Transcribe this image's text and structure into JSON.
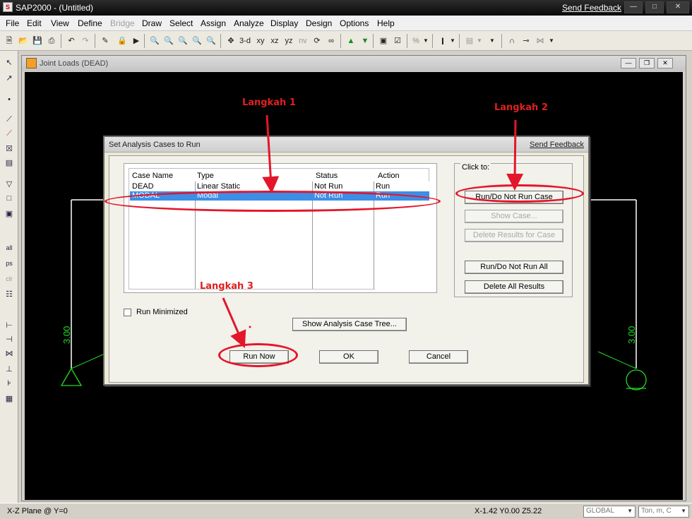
{
  "app": {
    "title": "SAP2000 - (Untitled)",
    "send_feedback": "Send Feedback",
    "logo": "S"
  },
  "menu": {
    "items": [
      "File",
      "Edit",
      "View",
      "Define",
      "Bridge",
      "Draw",
      "Select",
      "Assign",
      "Analyze",
      "Display",
      "Design",
      "Options",
      "Help"
    ]
  },
  "toolbar": {
    "labels": {
      "3d": "3-d",
      "xy": "xy",
      "xz": "xz",
      "yz": "yz",
      "nv": "nv",
      "pct": "%"
    }
  },
  "window": {
    "title": "Joint Loads (DEAD)"
  },
  "canvas": {
    "left_label": "3.00",
    "right_label": "3.00",
    "colors": {
      "structure": "#ffffff",
      "supports": "#22dd22"
    }
  },
  "dialog": {
    "title": "Set Analysis Cases to Run",
    "send_feedback": "Send Feedback",
    "columns": [
      "Case Name",
      "Type",
      "Status",
      "Action"
    ],
    "rows": [
      {
        "name": "DEAD",
        "type": "Linear Static",
        "status": "Not Run",
        "action": "Run"
      },
      {
        "name": "MODAL",
        "type": "Modal",
        "status": "Not Run",
        "action": "Run"
      }
    ],
    "click_to": "Click to:",
    "buttons": {
      "run_do_not_run_case": "Run/Do Not Run Case",
      "show_case": "Show Case...",
      "delete_results_for_case": "Delete Results for Case",
      "run_do_not_run_all": "Run/Do Not Run All",
      "delete_all_results": "Delete All Results",
      "show_tree": "Show Analysis Case Tree...",
      "run_now": "Run Now",
      "ok": "OK",
      "cancel": "Cancel"
    },
    "run_minimized": "Run Minimized",
    "run_minimized_checked": false,
    "selected_row": 1
  },
  "annotations": {
    "step1": "Langkah 1",
    "step2": "Langkah 2",
    "step3": "Langkah 3",
    "color": "#e02020"
  },
  "status": {
    "view": "X-Z Plane @ Y=0",
    "coords": "X-1.42  Y0.00  Z5.22",
    "coord_system": "GLOBAL",
    "units": "Ton, m, C"
  }
}
